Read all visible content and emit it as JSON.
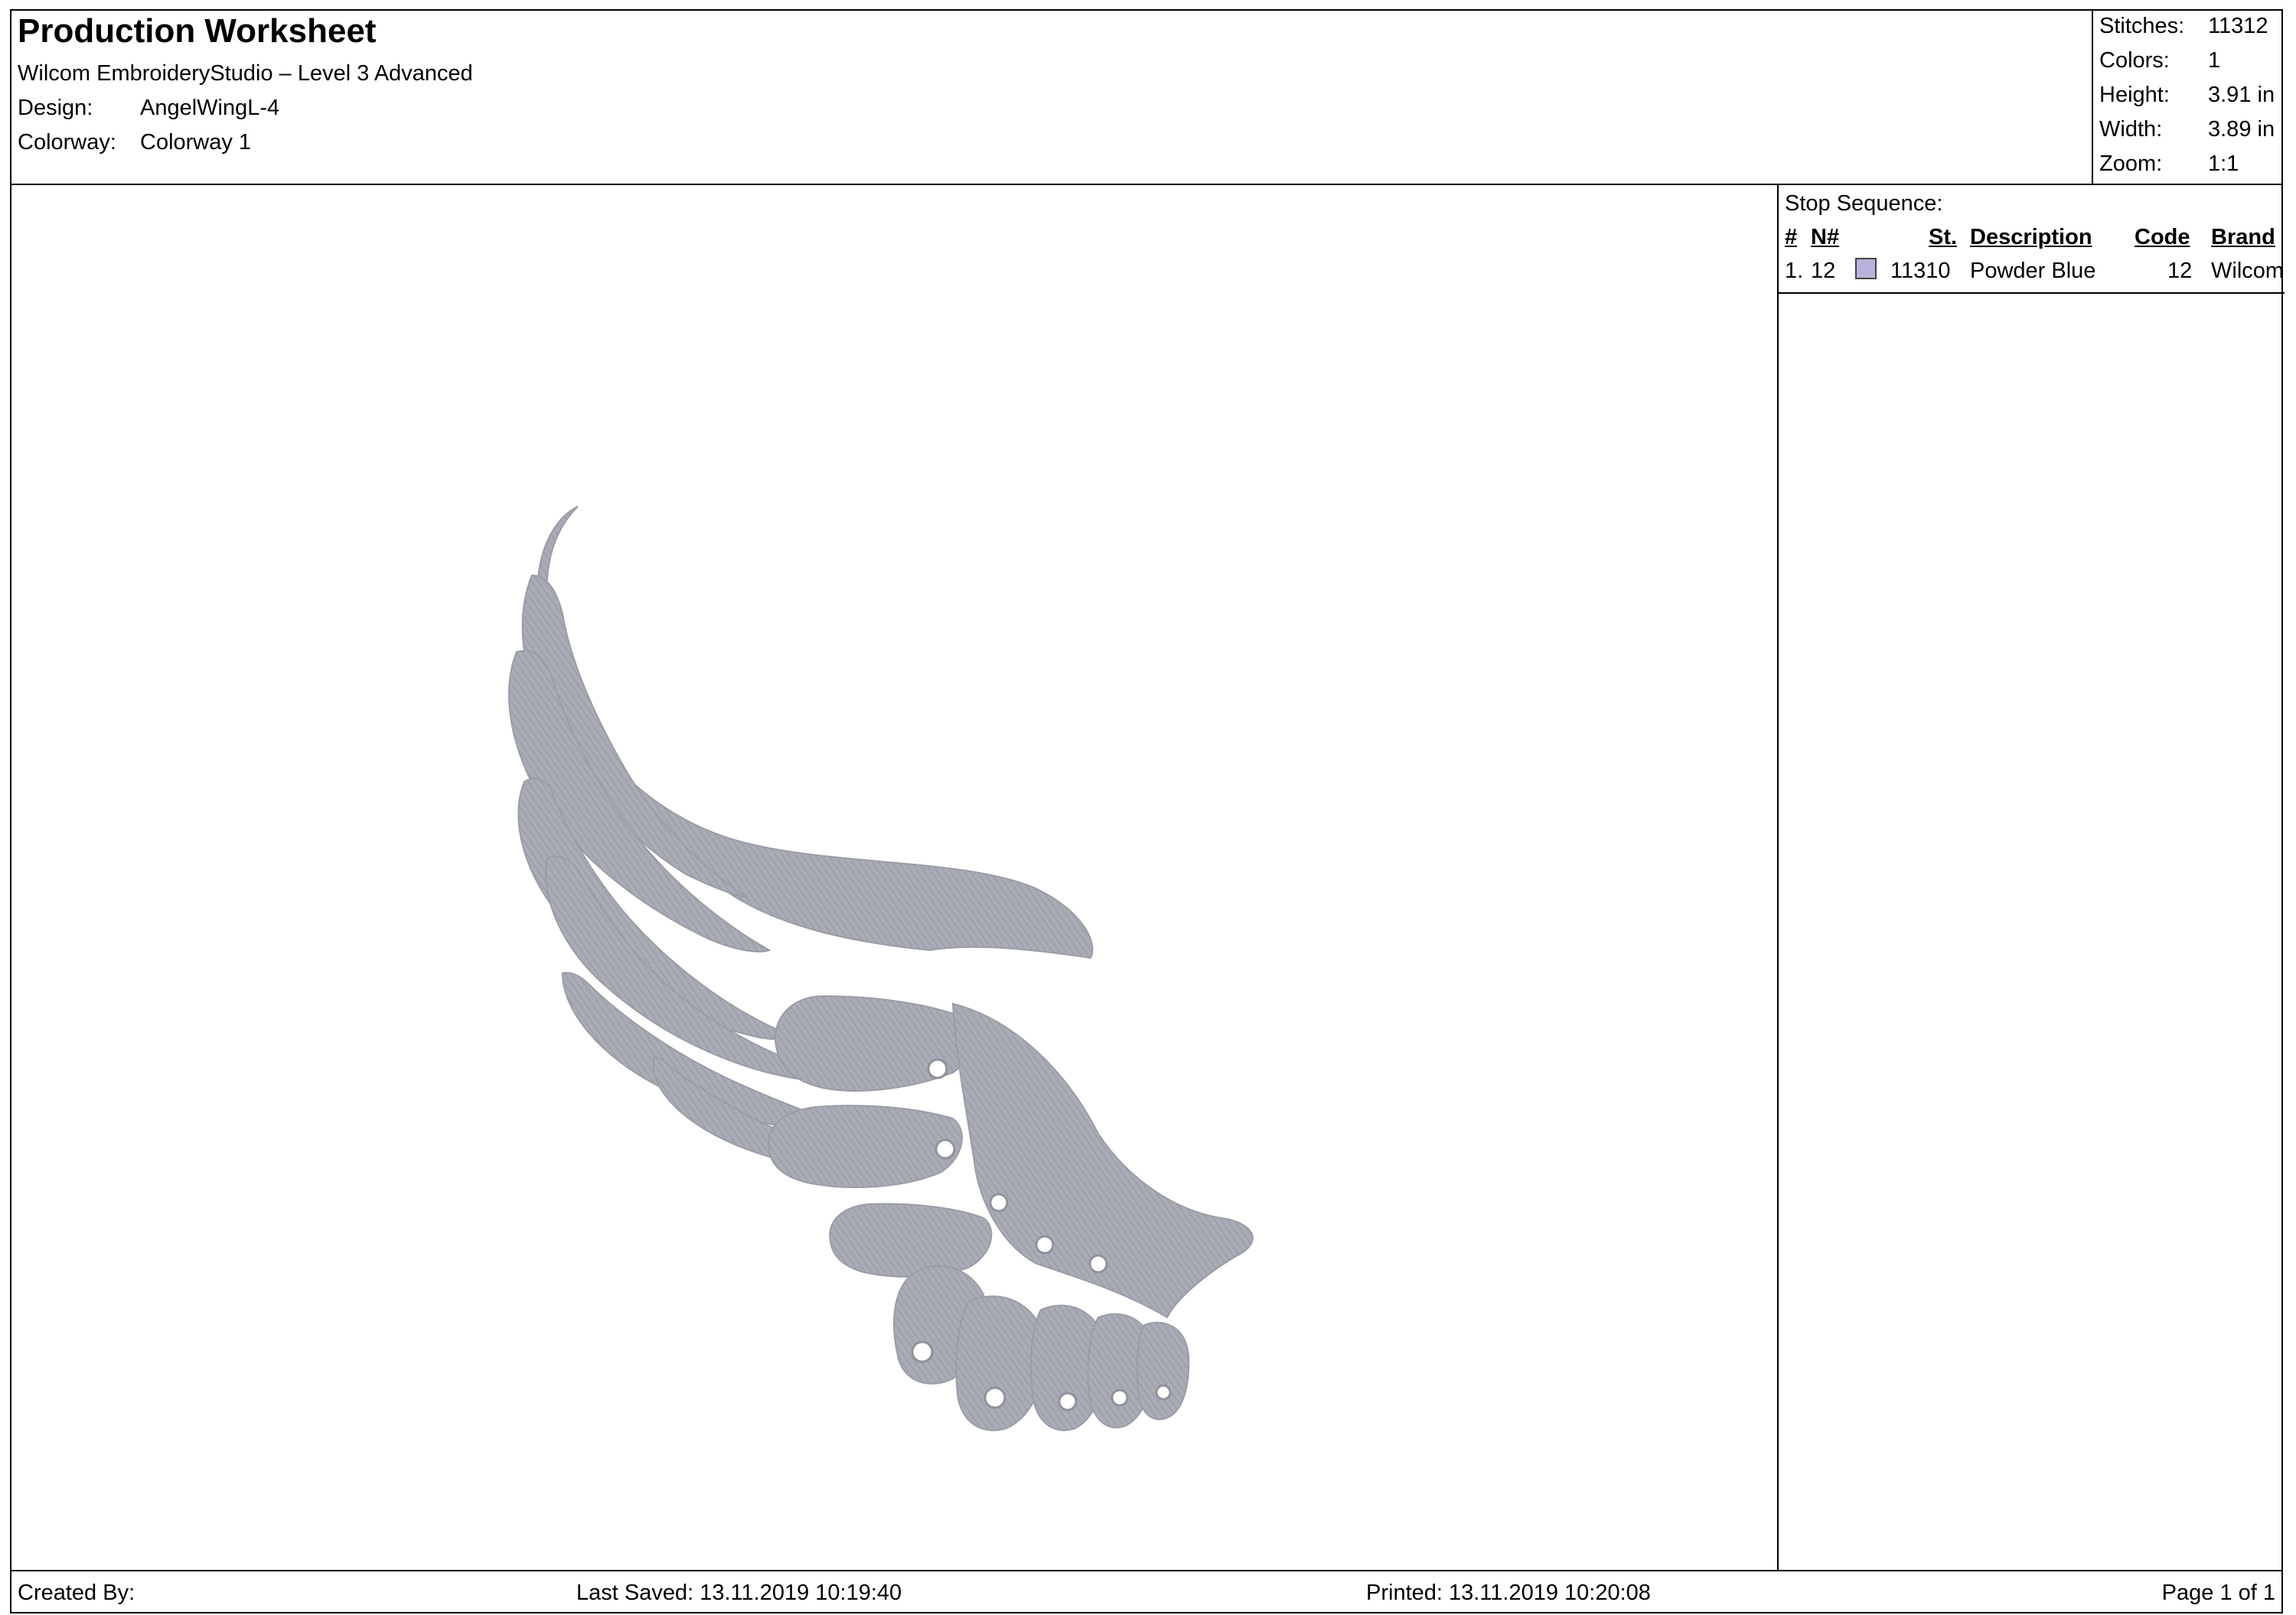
{
  "header": {
    "title": "Production Worksheet",
    "software": "Wilcom EmbroideryStudio – Level 3 Advanced",
    "design_label": "Design:",
    "design_value": "AngelWingL-4",
    "colorway_label": "Colorway:",
    "colorway_value": "Colorway 1"
  },
  "stats": {
    "stitches_label": "Stitches:",
    "stitches_value": "11312",
    "colors_label": "Colors:",
    "colors_value": "1",
    "height_label": "Height:",
    "height_value": "3.91 in",
    "width_label": "Width:",
    "width_value": "3.89 in",
    "zoom_label": "Zoom:",
    "zoom_value": "1:1"
  },
  "stop_sequence": {
    "title": "Stop Sequence:",
    "headers": {
      "num": "#",
      "needle": "N#",
      "stitches": "St.",
      "description": "Description",
      "code": "Code",
      "brand": "Brand"
    },
    "rows": [
      {
        "num": "1.",
        "needle": "12",
        "swatch_color": "#b8b3dc",
        "stitches": "11310",
        "description": "Powder Blue",
        "code": "12",
        "brand": "Wilcom"
      }
    ]
  },
  "design_preview": {
    "thread_color": "#a6a8b2",
    "shadow_color": "#8c8e98"
  },
  "footer": {
    "created_by": "Created By:",
    "last_saved": "Last Saved: 13.11.2019 10:19:40",
    "printed": "Printed: 13.11.2019 10:20:08",
    "page": "Page 1 of 1"
  }
}
